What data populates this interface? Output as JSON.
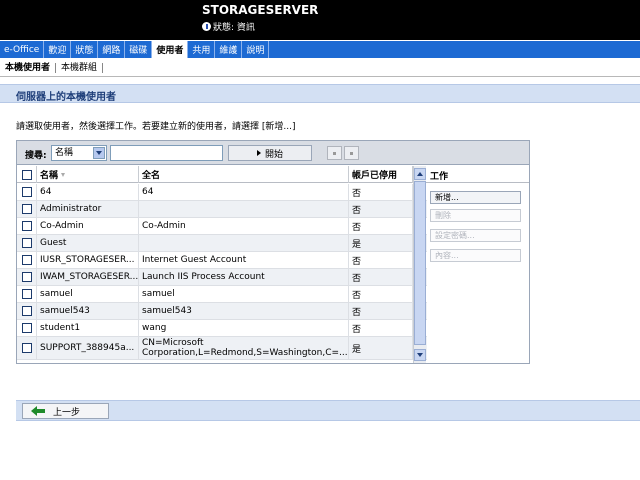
{
  "header": {
    "server_name": "STORAGESERVER",
    "status": "狀態: 資訊"
  },
  "nav": [
    "e-Office",
    "歡迎",
    "狀態",
    "網路",
    "磁碟",
    "使用者",
    "共用",
    "維護",
    "說明"
  ],
  "nav_active_index": 5,
  "subnav": [
    "本機使用者",
    "本機群組"
  ],
  "subnav_active_index": 0,
  "page_title": "伺服器上的本機使用者",
  "instructions": "請選取使用者，然後選擇工作。若要建立新的使用者，請選擇 [新增...]",
  "search": {
    "label": "搜尋:",
    "field_value": "名稱",
    "query": "",
    "start_label": "開始"
  },
  "table": {
    "columns": [
      "名稱",
      "全名",
      "帳戶已停用"
    ],
    "rows": [
      {
        "name": "64",
        "full_name": "64",
        "disabled": "否"
      },
      {
        "name": "Administrator",
        "full_name": "",
        "disabled": "否"
      },
      {
        "name": "Co-Admin",
        "full_name": "Co-Admin",
        "disabled": "否"
      },
      {
        "name": "Guest",
        "full_name": "",
        "disabled": "是"
      },
      {
        "name": "IUSR_STORAGESER...",
        "full_name": "Internet Guest Account",
        "disabled": "否"
      },
      {
        "name": "IWAM_STORAGESER...",
        "full_name": "Launch IIS Process Account",
        "disabled": "否"
      },
      {
        "name": "samuel",
        "full_name": "samuel",
        "disabled": "否"
      },
      {
        "name": "samuel543",
        "full_name": "samuel543",
        "disabled": "否"
      },
      {
        "name": "student1",
        "full_name": "wang",
        "disabled": "否"
      },
      {
        "name": "SUPPORT_388945a...",
        "full_name": "CN=Microsoft Corporation,L=Redmond,S=Washington,C=...",
        "disabled": "是"
      }
    ]
  },
  "tasks": {
    "title": "工作",
    "items": [
      {
        "label": "新增...",
        "enabled": true
      },
      {
        "label": "刪除",
        "enabled": false
      },
      {
        "label": "設定密碼...",
        "enabled": false
      },
      {
        "label": "內容...",
        "enabled": false
      }
    ]
  },
  "footer": {
    "back_label": "上一步"
  },
  "colors": {
    "nav_blue": "#1d6ad3",
    "band_blue": "#d3e0f3",
    "header_black": "#000000"
  }
}
